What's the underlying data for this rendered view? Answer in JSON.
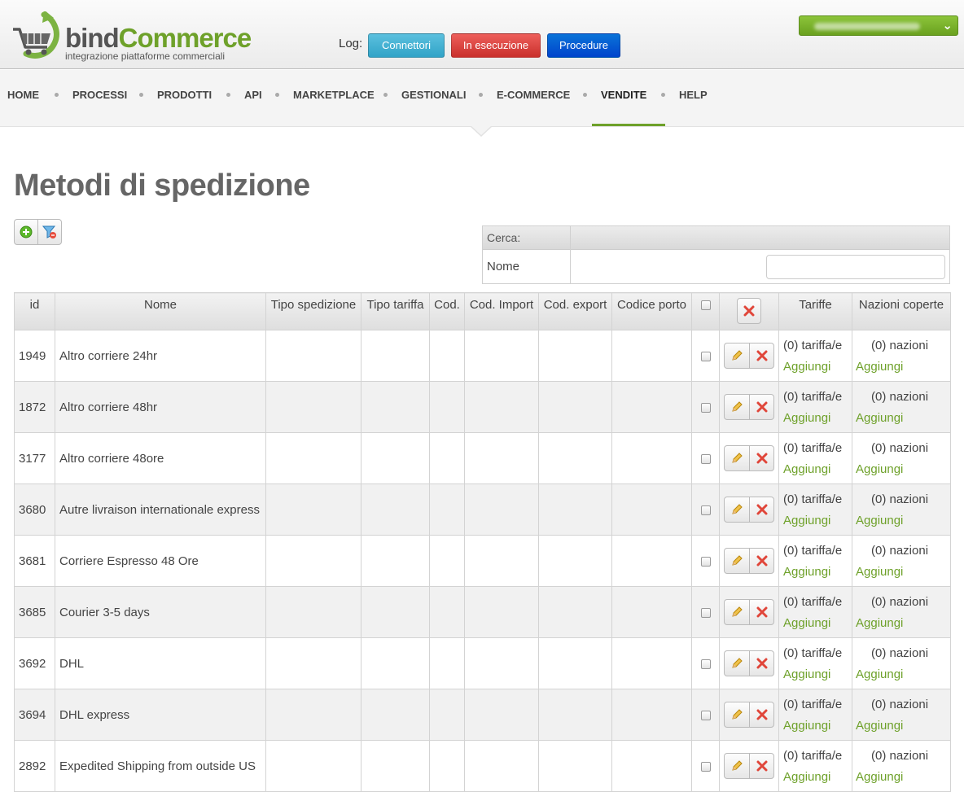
{
  "header": {
    "logo": {
      "part1": "bind",
      "part2": "Commerce",
      "subtitle": "integrazione piattaforme commerciali"
    },
    "log_label": "Log:",
    "buttons": {
      "connettori": "Connettori",
      "in_esecuzione": "In esecuzione",
      "procedure": "Procedure"
    }
  },
  "nav": {
    "items": [
      "HOME",
      "PROCESSI",
      "PRODOTTI",
      "API",
      "MARKETPLACE",
      "GESTIONALI",
      "E-COMMERCE",
      "VENDITE",
      "HELP"
    ],
    "active": "VENDITE"
  },
  "page": {
    "title": "Metodi di spedizione"
  },
  "search": {
    "header": "Cerca:",
    "field_label": "Nome",
    "value": ""
  },
  "table": {
    "columns": {
      "id": "id",
      "nome": "Nome",
      "tipo_spedizione": "Tipo spedizione",
      "tipo_tariffa": "Tipo tariffa",
      "cod": "Cod.",
      "cod_import": "Cod. Import",
      "cod_export": "Cod. export",
      "codice_porto": "Codice porto",
      "tariffe": "Tariffe",
      "nazioni": "Nazioni coperte"
    },
    "rows": [
      {
        "id": "1949",
        "nome": "Altro corriere 24hr",
        "tariffe": "(0) tariffa/e",
        "nazioni": "(0) nazioni",
        "aggiungi": "Aggiungi"
      },
      {
        "id": "1872",
        "nome": "Altro corriere 48hr",
        "tariffe": "(0) tariffa/e",
        "nazioni": "(0) nazioni",
        "aggiungi": "Aggiungi"
      },
      {
        "id": "3177",
        "nome": "Altro corriere 48ore",
        "tariffe": "(0) tariffa/e",
        "nazioni": "(0) nazioni",
        "aggiungi": "Aggiungi"
      },
      {
        "id": "3680",
        "nome": "Autre livraison internationale express",
        "tariffe": "(0) tariffa/e",
        "nazioni": "(0) nazioni",
        "aggiungi": "Aggiungi"
      },
      {
        "id": "3681",
        "nome": "Corriere Espresso 48 Ore",
        "tariffe": "(0) tariffa/e",
        "nazioni": "(0) nazioni",
        "aggiungi": "Aggiungi"
      },
      {
        "id": "3685",
        "nome": "Courier 3-5 days",
        "tariffe": "(0) tariffa/e",
        "nazioni": "(0) nazioni",
        "aggiungi": "Aggiungi"
      },
      {
        "id": "3692",
        "nome": "DHL",
        "tariffe": "(0) tariffa/e",
        "nazioni": "(0) nazioni",
        "aggiungi": "Aggiungi"
      },
      {
        "id": "3694",
        "nome": "DHL express",
        "tariffe": "(0) tariffa/e",
        "nazioni": "(0) nazioni",
        "aggiungi": "Aggiungi"
      },
      {
        "id": "2892",
        "nome": "Expedited Shipping from outside US",
        "tariffe": "(0) tariffa/e",
        "nazioni": "(0) nazioni",
        "aggiungi": "Aggiungi"
      }
    ]
  },
  "colors": {
    "accent": "#6ea12a",
    "info": "#5bc0de",
    "danger": "#d9534f",
    "primary": "#0044cc"
  },
  "icons": {
    "add": "plus-circle-icon",
    "filter_reset": "filter-remove-icon",
    "edit": "pencil-icon",
    "delete": "x-icon",
    "user_menu": "chevron-down-icon"
  }
}
